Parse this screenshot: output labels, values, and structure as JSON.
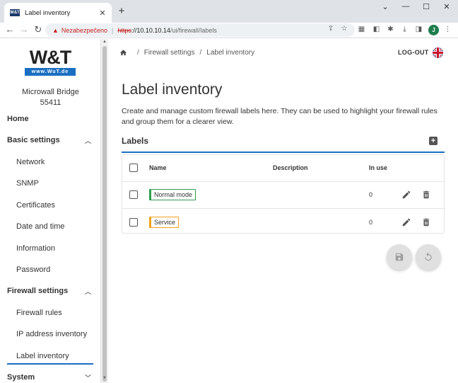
{
  "browser": {
    "tab_title": "Label inventory",
    "favicon_text": "W&T",
    "tab_close": "✕",
    "new_tab": "+",
    "not_secure": "Nezabezpečeno",
    "url_scheme": "https",
    "url_host": "://10.10.10.14",
    "url_path": "/ui/firewall/labels",
    "profile_initial": "J"
  },
  "sidebar": {
    "logo_text": "W&T",
    "logo_sub": "www.WuT.de",
    "device_name": "Microwall Bridge",
    "device_id": "55411",
    "items": [
      {
        "label": "Home",
        "type": "top"
      },
      {
        "label": "Basic settings",
        "type": "group"
      },
      {
        "label": "Network",
        "type": "sub"
      },
      {
        "label": "SNMP",
        "type": "sub"
      },
      {
        "label": "Certificates",
        "type": "sub"
      },
      {
        "label": "Date and time",
        "type": "sub"
      },
      {
        "label": "Information",
        "type": "sub"
      },
      {
        "label": "Password",
        "type": "sub"
      },
      {
        "label": "Firewall settings",
        "type": "group"
      },
      {
        "label": "Firewall rules",
        "type": "sub"
      },
      {
        "label": "IP address inventory",
        "type": "sub"
      },
      {
        "label": "Label inventory",
        "type": "sub",
        "active": true
      },
      {
        "label": "System",
        "type": "group"
      }
    ]
  },
  "header": {
    "breadcrumb": [
      "Firewall settings",
      "Label inventory"
    ],
    "logout": "LOG-OUT"
  },
  "main": {
    "title": "Label inventory",
    "description": "Create and manage custom firewall labels here. They can be used to highlight your firewall rules and group them for a clearer view.",
    "section_title": "Labels",
    "add_symbol": "+",
    "columns": [
      "Name",
      "Description",
      "In use"
    ],
    "rows": [
      {
        "name": "Normal mode",
        "description": "",
        "in_use": "0",
        "color": "#2e9d4f"
      },
      {
        "name": "Service",
        "description": "",
        "in_use": "0",
        "color": "#f0a020"
      }
    ]
  },
  "colors": {
    "accent": "#1b6fc2",
    "text": "#333333"
  }
}
